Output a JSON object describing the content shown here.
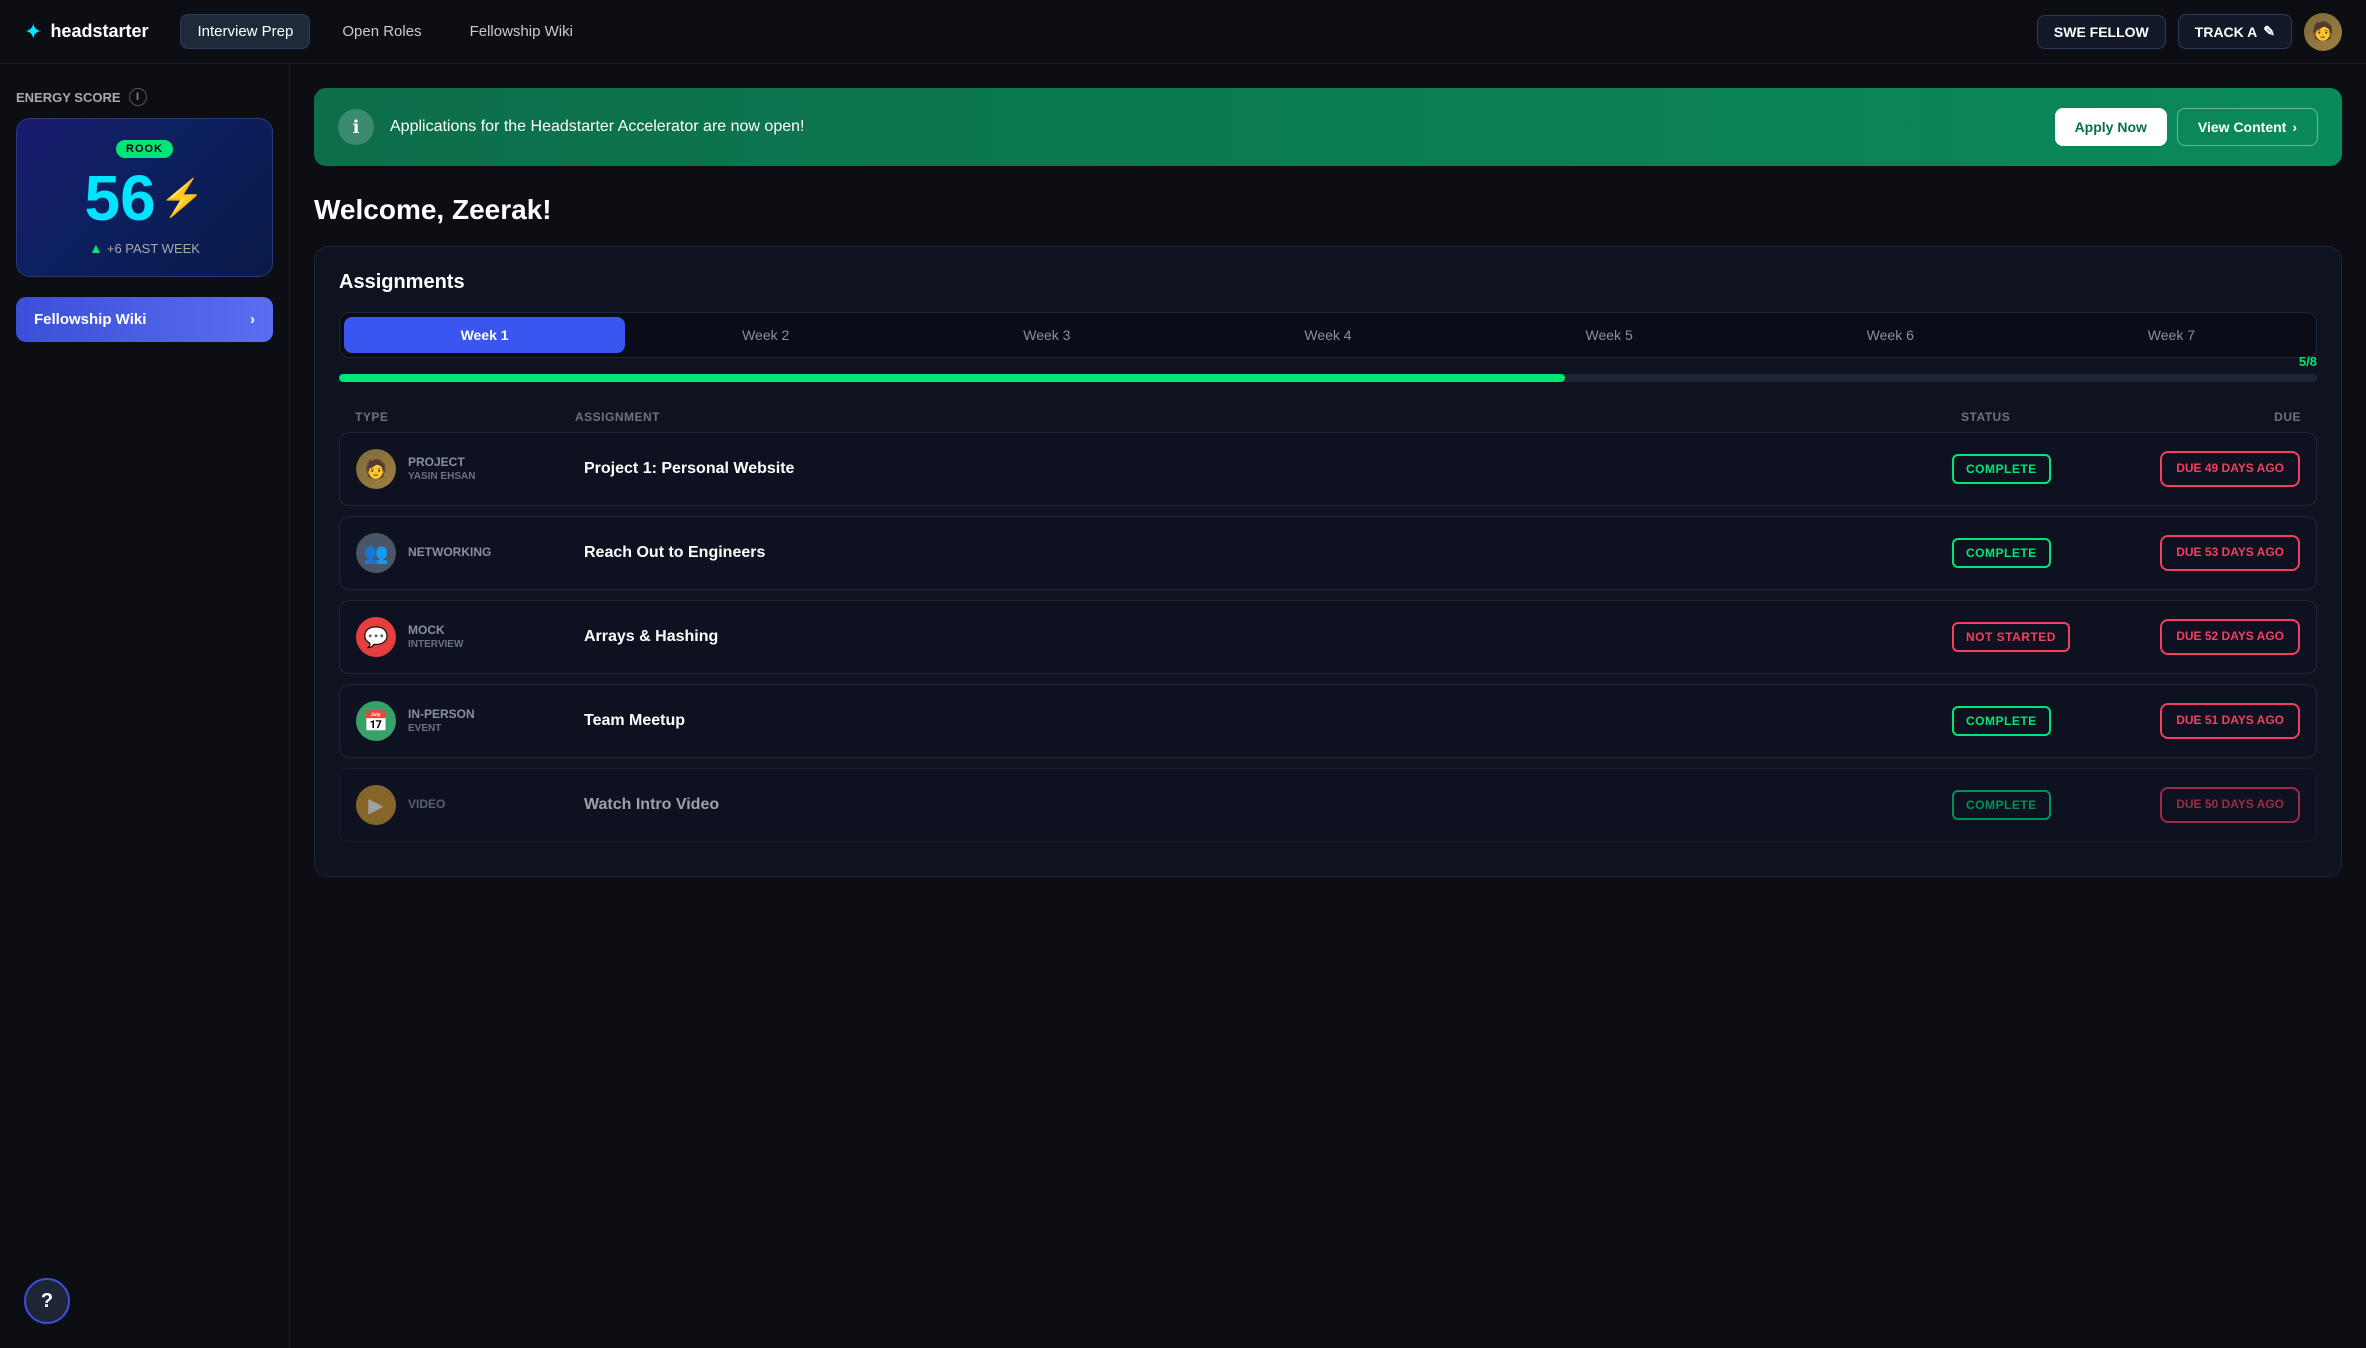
{
  "navbar": {
    "logo_text": "headstarter",
    "nav_items": [
      {
        "label": "Interview Prep",
        "active": true
      },
      {
        "label": "Open Roles",
        "active": false
      },
      {
        "label": "Fellowship Wiki",
        "active": false
      }
    ],
    "swe_fellow_label": "SWE FELLOW",
    "track_label": "TRACK A",
    "track_icon": "✎"
  },
  "sidebar": {
    "energy_score_label": "Energy Score",
    "rank": "ROOK",
    "score": "56",
    "delta_label": "+6 PAST WEEK",
    "fellowship_wiki_label": "Fellowship Wiki"
  },
  "banner": {
    "text": "Applications for the Headstarter Accelerator are now open!",
    "apply_label": "Apply Now",
    "view_label": "View Content",
    "icon": "ℹ"
  },
  "welcome": {
    "title": "Welcome, Zeerak!"
  },
  "assignments": {
    "title": "Assignments",
    "weeks": [
      {
        "label": "Week 1",
        "active": true
      },
      {
        "label": "Week 2",
        "active": false
      },
      {
        "label": "Week 3",
        "active": false
      },
      {
        "label": "Week 4",
        "active": false
      },
      {
        "label": "Week 5",
        "active": false
      },
      {
        "label": "Week 6",
        "active": false
      },
      {
        "label": "Week 7",
        "active": false
      }
    ],
    "progress_current": 5,
    "progress_total": 8,
    "progress_pct": 62,
    "columns": {
      "type": "TYPE",
      "assignment": "ASSIGNMENT",
      "status": "STATUS",
      "due": "DUE"
    },
    "rows": [
      {
        "type": "PROJECT",
        "type_sub": "YASIN EHSAN",
        "icon_type": "project",
        "icon": "👤",
        "name": "Project 1: Personal Website",
        "status": "COMPLETE",
        "status_type": "complete",
        "due": "DUE 49 DAYS AGO",
        "due_type": "overdue"
      },
      {
        "type": "NETWORKING",
        "type_sub": "",
        "icon_type": "networking",
        "icon": "👥",
        "name": "Reach Out to Engineers",
        "status": "COMPLETE",
        "status_type": "complete",
        "due": "DUE 53 DAYS AGO",
        "due_type": "overdue"
      },
      {
        "type": "MOCK",
        "type_sub": "INTERVIEW",
        "icon_type": "mock",
        "icon": "💬",
        "name": "Arrays & Hashing",
        "status": "NOT STARTED",
        "status_type": "not-started",
        "due": "DUE 52 DAYS AGO",
        "due_type": "overdue"
      },
      {
        "type": "IN-PERSON",
        "type_sub": "EVENT",
        "icon_type": "event",
        "icon": "📅",
        "name": "Team Meetup",
        "status": "COMPLETE",
        "status_type": "complete",
        "due": "DUE 51 DAYS AGO",
        "due_type": "overdue"
      },
      {
        "type": "VIDEO",
        "type_sub": "",
        "icon_type": "video",
        "icon": "▶",
        "name": "Watch Intro Video",
        "status": "COMPLETE",
        "status_type": "complete",
        "due": "DUE 50 DAYS AGO",
        "due_type": "overdue"
      }
    ]
  },
  "help": {
    "label": "?"
  }
}
